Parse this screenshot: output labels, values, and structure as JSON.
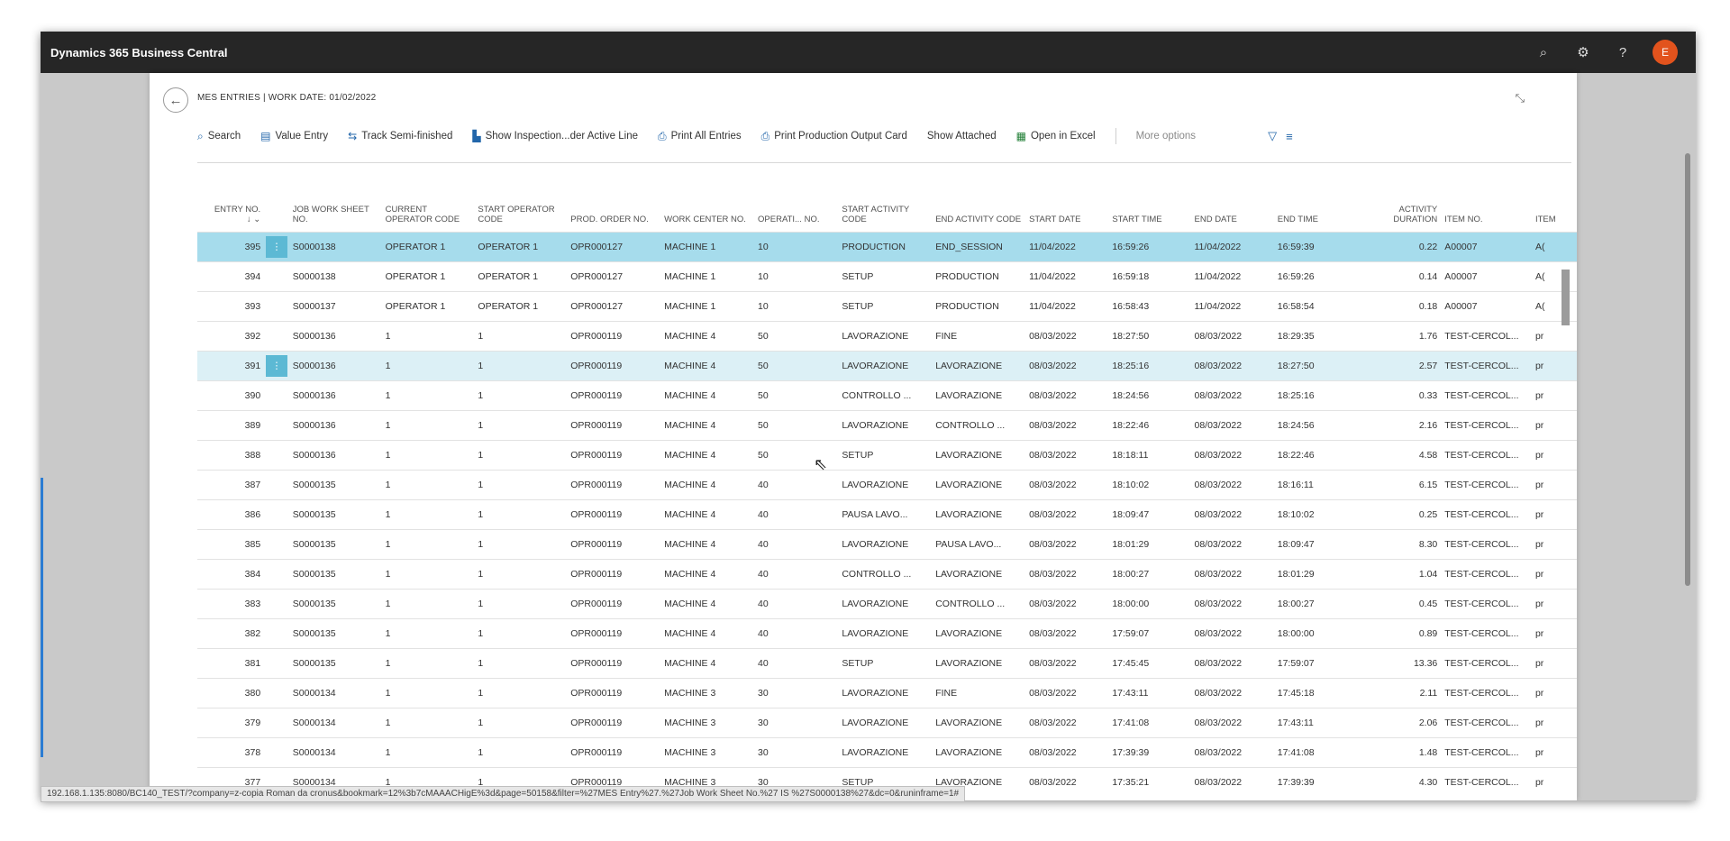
{
  "app": {
    "title": "Dynamics 365 Business Central",
    "user_initial": "E"
  },
  "page": {
    "title": "MES ENTRIES | WORK DATE: 01/02/2022"
  },
  "actions": {
    "search": "Search",
    "value_entry": "Value Entry",
    "track_semi": "Track Semi-finished",
    "show_inspection": "Show Inspection...der Active Line",
    "print_all": "Print All Entries",
    "print_card": "Print Production Output Card",
    "show_attached": "Show Attached",
    "open_excel": "Open in Excel",
    "more_options": "More options"
  },
  "columns": {
    "entry_no": "ENTRY NO.",
    "sort": "↓ ⌄",
    "job_ws": "JOB WORK SHEET NO.",
    "cur_op": "CURRENT OPERATOR CODE",
    "start_op": "START OPERATOR CODE",
    "prod_order": "PROD. ORDER NO.",
    "work_center": "WORK CENTER NO.",
    "operation": "OPERATI... NO.",
    "start_act": "START ACTIVITY CODE",
    "end_act": "END ACTIVITY CODE",
    "start_date": "START DATE",
    "start_time": "START TIME",
    "end_date": "END DATE",
    "end_time": "END TIME",
    "duration": "ACTIVITY DURATION",
    "item_no": "ITEM NO.",
    "item_desc": "ITEM"
  },
  "rows": [
    [
      "395",
      "S0000138",
      "OPERATOR 1",
      "OPERATOR 1",
      "OPR000127",
      "MACHINE 1",
      "10",
      "PRODUCTION",
      "END_SESSION",
      "11/04/2022",
      "16:59:26",
      "11/04/2022",
      "16:59:39",
      "0.22",
      "A00007",
      "A("
    ],
    [
      "394",
      "S0000138",
      "OPERATOR 1",
      "OPERATOR 1",
      "OPR000127",
      "MACHINE 1",
      "10",
      "SETUP",
      "PRODUCTION",
      "11/04/2022",
      "16:59:18",
      "11/04/2022",
      "16:59:26",
      "0.14",
      "A00007",
      "A("
    ],
    [
      "393",
      "S0000137",
      "OPERATOR 1",
      "OPERATOR 1",
      "OPR000127",
      "MACHINE 1",
      "10",
      "SETUP",
      "PRODUCTION",
      "11/04/2022",
      "16:58:43",
      "11/04/2022",
      "16:58:54",
      "0.18",
      "A00007",
      "A("
    ],
    [
      "392",
      "S0000136",
      "1",
      "1",
      "OPR000119",
      "MACHINE 4",
      "50",
      "LAVORAZIONE",
      "FINE",
      "08/03/2022",
      "18:27:50",
      "08/03/2022",
      "18:29:35",
      "1.76",
      "TEST-CERCOL...",
      "pr"
    ],
    [
      "391",
      "S0000136",
      "1",
      "1",
      "OPR000119",
      "MACHINE 4",
      "50",
      "LAVORAZIONE",
      "LAVORAZIONE",
      "08/03/2022",
      "18:25:16",
      "08/03/2022",
      "18:27:50",
      "2.57",
      "TEST-CERCOL...",
      "pr"
    ],
    [
      "390",
      "S0000136",
      "1",
      "1",
      "OPR000119",
      "MACHINE 4",
      "50",
      "CONTROLLO ...",
      "LAVORAZIONE",
      "08/03/2022",
      "18:24:56",
      "08/03/2022",
      "18:25:16",
      "0.33",
      "TEST-CERCOL...",
      "pr"
    ],
    [
      "389",
      "S0000136",
      "1",
      "1",
      "OPR000119",
      "MACHINE 4",
      "50",
      "LAVORAZIONE",
      "CONTROLLO ...",
      "08/03/2022",
      "18:22:46",
      "08/03/2022",
      "18:24:56",
      "2.16",
      "TEST-CERCOL...",
      "pr"
    ],
    [
      "388",
      "S0000136",
      "1",
      "1",
      "OPR000119",
      "MACHINE 4",
      "50",
      "SETUP",
      "LAVORAZIONE",
      "08/03/2022",
      "18:18:11",
      "08/03/2022",
      "18:22:46",
      "4.58",
      "TEST-CERCOL...",
      "pr"
    ],
    [
      "387",
      "S0000135",
      "1",
      "1",
      "OPR000119",
      "MACHINE 4",
      "40",
      "LAVORAZIONE",
      "LAVORAZIONE",
      "08/03/2022",
      "18:10:02",
      "08/03/2022",
      "18:16:11",
      "6.15",
      "TEST-CERCOL...",
      "pr"
    ],
    [
      "386",
      "S0000135",
      "1",
      "1",
      "OPR000119",
      "MACHINE 4",
      "40",
      "PAUSA LAVO...",
      "LAVORAZIONE",
      "08/03/2022",
      "18:09:47",
      "08/03/2022",
      "18:10:02",
      "0.25",
      "TEST-CERCOL...",
      "pr"
    ],
    [
      "385",
      "S0000135",
      "1",
      "1",
      "OPR000119",
      "MACHINE 4",
      "40",
      "LAVORAZIONE",
      "PAUSA LAVO...",
      "08/03/2022",
      "18:01:29",
      "08/03/2022",
      "18:09:47",
      "8.30",
      "TEST-CERCOL...",
      "pr"
    ],
    [
      "384",
      "S0000135",
      "1",
      "1",
      "OPR000119",
      "MACHINE 4",
      "40",
      "CONTROLLO ...",
      "LAVORAZIONE",
      "08/03/2022",
      "18:00:27",
      "08/03/2022",
      "18:01:29",
      "1.04",
      "TEST-CERCOL...",
      "pr"
    ],
    [
      "383",
      "S0000135",
      "1",
      "1",
      "OPR000119",
      "MACHINE 4",
      "40",
      "LAVORAZIONE",
      "CONTROLLO ...",
      "08/03/2022",
      "18:00:00",
      "08/03/2022",
      "18:00:27",
      "0.45",
      "TEST-CERCOL...",
      "pr"
    ],
    [
      "382",
      "S0000135",
      "1",
      "1",
      "OPR000119",
      "MACHINE 4",
      "40",
      "LAVORAZIONE",
      "LAVORAZIONE",
      "08/03/2022",
      "17:59:07",
      "08/03/2022",
      "18:00:00",
      "0.89",
      "TEST-CERCOL...",
      "pr"
    ],
    [
      "381",
      "S0000135",
      "1",
      "1",
      "OPR000119",
      "MACHINE 4",
      "40",
      "SETUP",
      "LAVORAZIONE",
      "08/03/2022",
      "17:45:45",
      "08/03/2022",
      "17:59:07",
      "13.36",
      "TEST-CERCOL...",
      "pr"
    ],
    [
      "380",
      "S0000134",
      "1",
      "1",
      "OPR000119",
      "MACHINE 3",
      "30",
      "LAVORAZIONE",
      "FINE",
      "08/03/2022",
      "17:43:11",
      "08/03/2022",
      "17:45:18",
      "2.11",
      "TEST-CERCOL...",
      "pr"
    ],
    [
      "379",
      "S0000134",
      "1",
      "1",
      "OPR000119",
      "MACHINE 3",
      "30",
      "LAVORAZIONE",
      "LAVORAZIONE",
      "08/03/2022",
      "17:41:08",
      "08/03/2022",
      "17:43:11",
      "2.06",
      "TEST-CERCOL...",
      "pr"
    ],
    [
      "378",
      "S0000134",
      "1",
      "1",
      "OPR000119",
      "MACHINE 3",
      "30",
      "LAVORAZIONE",
      "LAVORAZIONE",
      "08/03/2022",
      "17:39:39",
      "08/03/2022",
      "17:41:08",
      "1.48",
      "TEST-CERCOL...",
      "pr"
    ],
    [
      "377",
      "S0000134",
      "1",
      "1",
      "OPR000119",
      "MACHINE 3",
      "30",
      "SETUP",
      "LAVORAZIONE",
      "08/03/2022",
      "17:35:21",
      "08/03/2022",
      "17:39:39",
      "4.30",
      "TEST-CERCOL...",
      "pr"
    ]
  ],
  "selected_rows": [
    0,
    4
  ],
  "status_url": "192.168.1.135:8080/BC140_TEST/?company=z-copia Roman da cronus&bookmark=12%3b7cMAAACHigE%3d&page=50158&filter=%27MES Entry%27.%27Job Work Sheet No.%27 IS %27S0000138%27&dc=0&runinframe=1#"
}
